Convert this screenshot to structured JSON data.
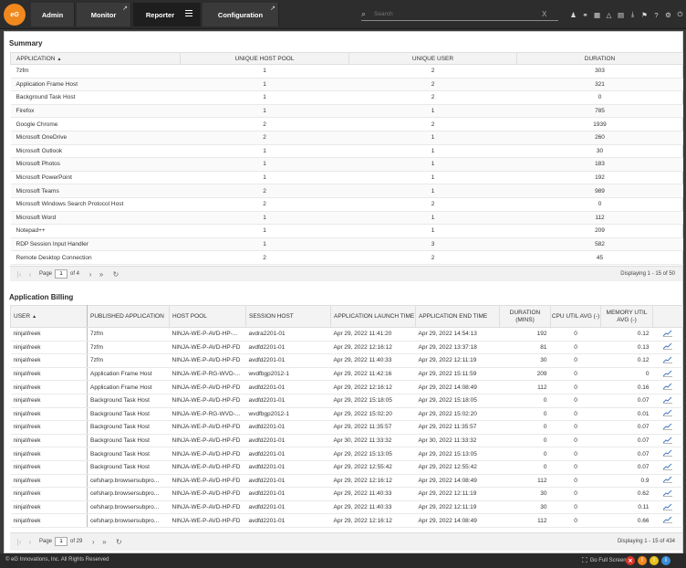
{
  "nav": {
    "logo_text": "eG",
    "tabs": [
      {
        "label": "Admin"
      },
      {
        "label": "Monitor"
      },
      {
        "label": "Reporter"
      },
      {
        "label": "Configuration"
      }
    ],
    "search_placeholder": "Search",
    "search_clear": "X"
  },
  "summary": {
    "title": "Summary",
    "columns": [
      "APPLICATION",
      "UNIQUE HOST POOL",
      "UNIQUE USER",
      "DURATION"
    ],
    "rows": [
      [
        "7zfm",
        "1",
        "2",
        "303"
      ],
      [
        "Application Frame Host",
        "1",
        "2",
        "321"
      ],
      [
        "Background Task Host",
        "1",
        "2",
        "0"
      ],
      [
        "Firefox",
        "1",
        "1",
        "785"
      ],
      [
        "Google Chrome",
        "2",
        "2",
        "1939"
      ],
      [
        "Microsoft OneDrive",
        "2",
        "1",
        "260"
      ],
      [
        "Microsoft Outlook",
        "1",
        "1",
        "30"
      ],
      [
        "Microsoft Photos",
        "1",
        "1",
        "183"
      ],
      [
        "Microsoft PowerPoint",
        "1",
        "1",
        "192"
      ],
      [
        "Microsoft Teams",
        "2",
        "1",
        "989"
      ],
      [
        "Microsoft Windows Search Protocol Host",
        "2",
        "2",
        "0"
      ],
      [
        "Microsoft Word",
        "1",
        "1",
        "112"
      ],
      [
        "Notepad++",
        "1",
        "1",
        "209"
      ],
      [
        "RDP Session Input Handler",
        "1",
        "3",
        "582"
      ],
      [
        "Remote Desktop Connection",
        "2",
        "2",
        "45"
      ]
    ],
    "pager": {
      "page_label": "Page",
      "page_value": "1",
      "of_label": "of 4"
    },
    "display_text": "Displaying 1 - 15 of 50"
  },
  "billing": {
    "title": "Application Billing",
    "columns": [
      "USER",
      "PUBLISHED APPLICATION",
      "HOST POOL",
      "SESSION HOST",
      "APPLICATION LAUNCH TIME",
      "APPLICATION END TIME",
      "DURATION (MINS)",
      "CPU UTIL AVG (-)",
      "MEMORY UTIL AVG (-)",
      ""
    ],
    "rows": [
      [
        "ninja\\freek",
        "7zfm",
        "NINJA-WE-P-AVD-HP-...",
        "avdra2201-01",
        "Apr 29, 2022 11:41:20",
        "Apr 29, 2022 14:54:13",
        "192",
        "0",
        "0.12"
      ],
      [
        "ninja\\freek",
        "7zfm",
        "NINJA-WE-P-AVD-HP-FD",
        "avdfd2201-01",
        "Apr 29, 2022 12:16:12",
        "Apr 29, 2022 13:37:18",
        "81",
        "0",
        "0.13"
      ],
      [
        "ninja\\freek",
        "7zfm",
        "NINJA-WE-P-AVD-HP-FD",
        "avdfd2201-01",
        "Apr 29, 2022 11:40:33",
        "Apr 29, 2022 12:11:19",
        "30",
        "0",
        "0.12"
      ],
      [
        "ninja\\freek",
        "Application Frame Host",
        "NINJA-WE-P-RG-WVD-...",
        "wvdfbgp2012-1",
        "Apr 29, 2022 11:42:16",
        "Apr 29, 2022 15:11:59",
        "209",
        "0",
        "0"
      ],
      [
        "ninja\\freek",
        "Application Frame Host",
        "NINJA-WE-P-AVD-HP-FD",
        "avdfd2201-01",
        "Apr 29, 2022 12:16:12",
        "Apr 29, 2022 14:08:49",
        "112",
        "0",
        "0.16"
      ],
      [
        "ninja\\freek",
        "Background Task Host",
        "NINJA-WE-P-AVD-HP-FD",
        "avdfd2201-01",
        "Apr 29, 2022 15:18:05",
        "Apr 29, 2022 15:18:05",
        "0",
        "0",
        "0.07"
      ],
      [
        "ninja\\freek",
        "Background Task Host",
        "NINJA-WE-P-RG-WVD-...",
        "wvdfbgp2012-1",
        "Apr 29, 2022 15:02:20",
        "Apr 29, 2022 15:02:20",
        "0",
        "0",
        "0.01"
      ],
      [
        "ninja\\freek",
        "Background Task Host",
        "NINJA-WE-P-AVD-HP-FD",
        "avdfd2201-01",
        "Apr 29, 2022 11:35:57",
        "Apr 29, 2022 11:35:57",
        "0",
        "0",
        "0.07"
      ],
      [
        "ninja\\freek",
        "Background Task Host",
        "NINJA-WE-P-AVD-HP-FD",
        "avdfd2201-01",
        "Apr 30, 2022 11:33:32",
        "Apr 30, 2022 11:33:32",
        "0",
        "0",
        "0.07"
      ],
      [
        "ninja\\freek",
        "Background Task Host",
        "NINJA-WE-P-AVD-HP-FD",
        "avdfd2201-01",
        "Apr 29, 2022 15:13:05",
        "Apr 29, 2022 15:13:05",
        "0",
        "0",
        "0.07"
      ],
      [
        "ninja\\freek",
        "Background Task Host",
        "NINJA-WE-P-AVD-HP-FD",
        "avdfd2201-01",
        "Apr 29, 2022 12:55:42",
        "Apr 29, 2022 12:55:42",
        "0",
        "0",
        "0.07"
      ],
      [
        "ninja\\freek",
        "cefsharp.browsersubpro...",
        "NINJA-WE-P-AVD-HP-FD",
        "avdfd2201-01",
        "Apr 29, 2022 12:16:12",
        "Apr 29, 2022 14:08:49",
        "112",
        "0",
        "0.9"
      ],
      [
        "ninja\\freek",
        "cefsharp.browsersubpro...",
        "NINJA-WE-P-AVD-HP-FD",
        "avdfd2201-01",
        "Apr 29, 2022 11:40:33",
        "Apr 29, 2022 12:11:19",
        "30",
        "0",
        "0.62"
      ],
      [
        "ninja\\freek",
        "cefsharp.browsersubpro...",
        "NINJA-WE-P-AVD-HP-FD",
        "avdfd2201-01",
        "Apr 29, 2022 11:40:33",
        "Apr 29, 2022 12:11:19",
        "30",
        "0",
        "0.11"
      ],
      [
        "ninja\\freek",
        "cefsharp.browsersubpro...",
        "NINJA-WE-P-AVD-HP-FD",
        "avdfd2201-01",
        "Apr 29, 2022 12:16:12",
        "Apr 29, 2022 14:08:49",
        "112",
        "0",
        "0.66"
      ]
    ],
    "pager": {
      "page_label": "Page",
      "page_value": "1",
      "of_label": "of 29"
    },
    "display_text": "Displaying 1 - 15 of 434"
  },
  "status": {
    "copyright": "© eG Innovations, Inc. All Rights Reserved",
    "fullscreen_label": "Go Full Screen",
    "alert_colors": [
      "#d9342b",
      "#f0881e",
      "#e6c31c",
      "#3a8fd6"
    ]
  }
}
